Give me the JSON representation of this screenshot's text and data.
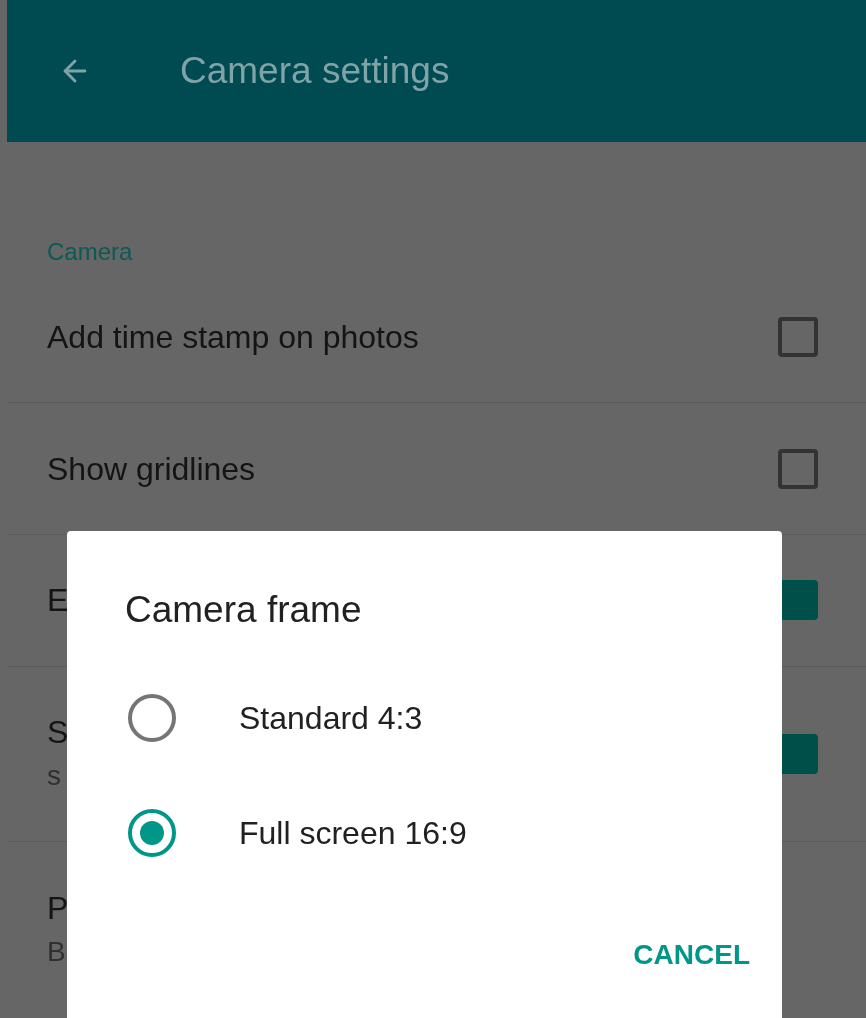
{
  "app_bar": {
    "title": "Camera settings"
  },
  "section": {
    "title": "Camera"
  },
  "rows": [
    {
      "lines": [
        "Add time stamp on photos"
      ],
      "checked": false
    },
    {
      "lines": [
        "Show gridlines"
      ],
      "checked": false
    },
    {
      "lines": [
        "E"
      ],
      "checked": true
    },
    {
      "lines": [
        "S",
        "s"
      ],
      "checked": true
    },
    {
      "lines": [
        "P",
        "B"
      ]
    }
  ],
  "dialog": {
    "title": "Camera frame",
    "options": [
      {
        "label": "Standard 4:3",
        "selected": false
      },
      {
        "label": "Full screen 16:9",
        "selected": true
      }
    ],
    "buttons": [
      "CANCEL"
    ]
  }
}
